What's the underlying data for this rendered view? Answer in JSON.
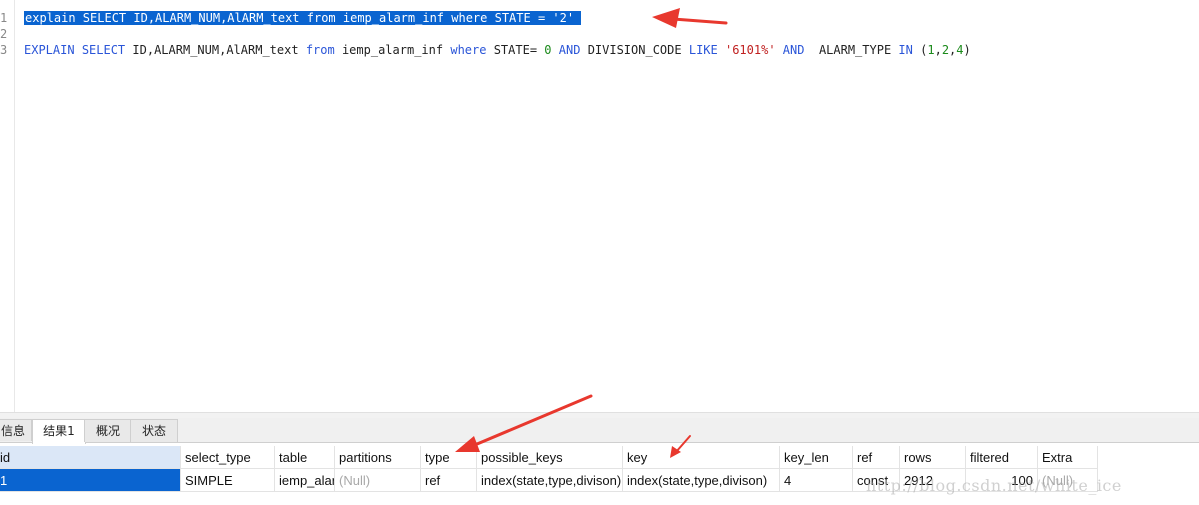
{
  "editor": {
    "line_numbers": [
      "1",
      "2",
      "3"
    ],
    "line1": {
      "full_text": "explain SELECT ID,ALARM_NUM,AlARM_text from iemp_alarm_inf where STATE = '2'"
    },
    "line3": {
      "kw_explain": "EXPLAIN",
      "kw_select": "SELECT",
      "cols": "ID,ALARM_NUM,AlARM_text",
      "kw_from": "from",
      "table": "iemp_alarm_inf",
      "kw_where": "where",
      "state": "STATE=",
      "state_val": "0",
      "kw_and1": "AND",
      "division": "DIVISION_CODE",
      "kw_like": "LIKE",
      "like_val": "'6101%'",
      "kw_and2": "AND",
      "alarm_type": "ALARM_TYPE",
      "kw_in": "IN",
      "paren_open": "(",
      "in_1": "1",
      "comma1": ",",
      "in_2": "2",
      "comma2": ",",
      "in_4": "4",
      "paren_close": ")"
    }
  },
  "tabs": [
    "信息",
    "结果1",
    "概况",
    "状态"
  ],
  "active_tab": "结果1",
  "result": {
    "columns": [
      "id",
      "select_type",
      "table",
      "partitions",
      "type",
      "possible_keys",
      "key",
      "key_len",
      "ref",
      "rows",
      "filtered",
      "Extra"
    ],
    "rows": [
      [
        "1",
        "SIMPLE",
        "iemp_alarm_inf",
        "(Null)",
        "ref",
        "index(state,type,divison)",
        "index(state,type,divison)",
        "4",
        "const",
        "2912",
        "100",
        "(Null)"
      ]
    ]
  },
  "watermark": "http://blog.csdn.net/white_ice",
  "colors": {
    "selection": "#0a64d0",
    "keyword": "#2a55d8",
    "string": "#c02020",
    "number": "#1a8a1a",
    "annotation_arrow": "#e8382e"
  }
}
